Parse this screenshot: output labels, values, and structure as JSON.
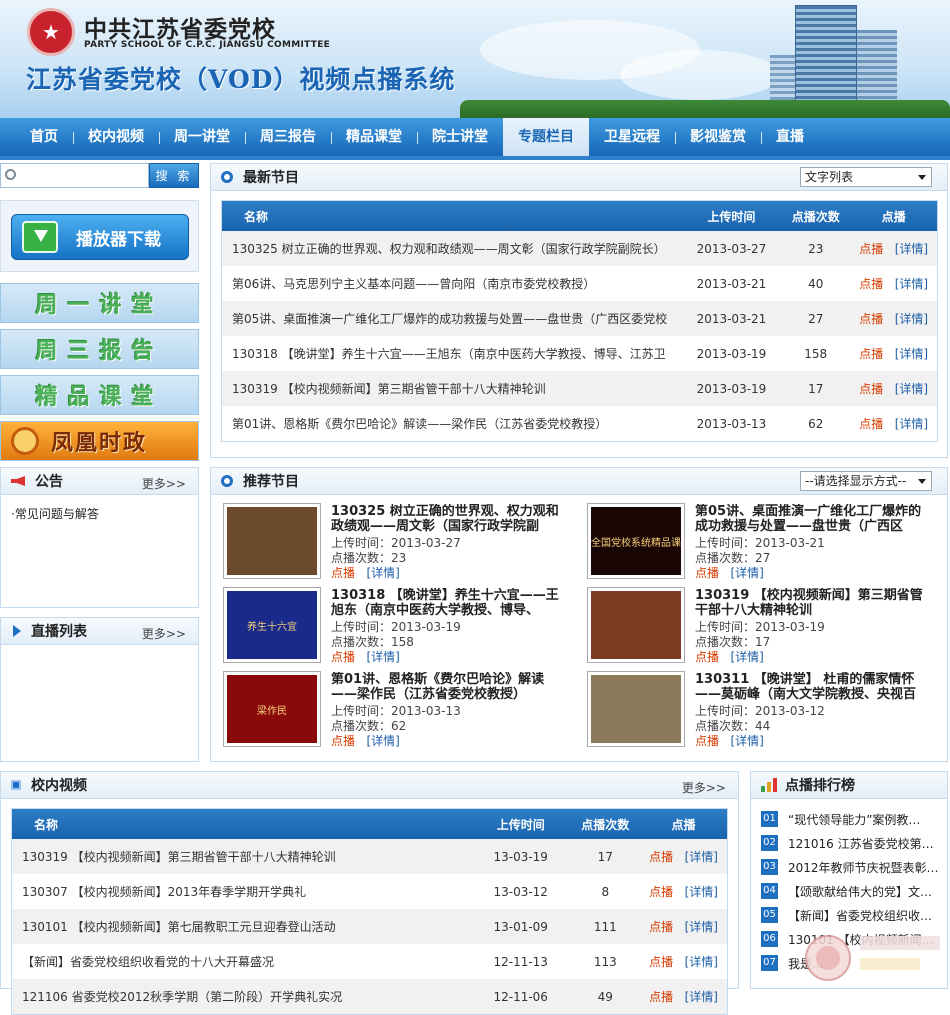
{
  "header": {
    "org_cn": "中共江苏省委党校",
    "org_en": "PARTY SCHOOL OF C.P.C. JIANGSU COMMITTEE",
    "system_title": "江苏省委党校（VOD）视频点播系统"
  },
  "nav": {
    "items": [
      "首页",
      "校内视频",
      "周一讲堂",
      "周三报告",
      "精品课堂",
      "院士讲堂",
      "专题栏目",
      "卫星远程",
      "影视鉴赏",
      "直播"
    ],
    "active_index": 6
  },
  "sidebar": {
    "search_button": "搜 索",
    "search_placeholder": "",
    "download_button": "播放器下载",
    "banners": [
      "周一讲堂",
      "周三报告",
      "精品课堂"
    ],
    "phoenix": "凤凰时政",
    "notice": {
      "title": "公告",
      "more": "更多>>",
      "items": [
        "·常见问题与解答"
      ]
    },
    "live": {
      "title": "直播列表",
      "more": "更多>>"
    }
  },
  "latest": {
    "title": "最新节目",
    "view_select": "文字列表",
    "columns": [
      "名称",
      "上传时间",
      "点播次数",
      "点播"
    ],
    "play_label": "点播",
    "detail_label": "[详情]",
    "rows": [
      {
        "name": "130325 树立正确的世界观、权力观和政绩观——周文彰（国家行政学院副院长）",
        "date": "2013-03-27",
        "count": "23"
      },
      {
        "name": "第06讲、马克思列宁主义基本问题——曾向阳（南京市委党校教授）",
        "date": "2013-03-21",
        "count": "40"
      },
      {
        "name": "第05讲、桌面推演一广维化工厂爆炸的成功救援与处置——盘世贵（广西区委党校",
        "date": "2013-03-21",
        "count": "27"
      },
      {
        "name": "130318 【晚讲堂】养生十六宜——王旭东（南京中医药大学教授、博导、江苏卫",
        "date": "2013-03-19",
        "count": "158"
      },
      {
        "name": "130319 【校内视频新闻】第三期省管干部十八大精神轮训",
        "date": "2013-03-19",
        "count": "17"
      },
      {
        "name": "第01讲、恩格斯《费尔巴哈论》解读——梁作民（江苏省委党校教授）",
        "date": "2013-03-13",
        "count": "62"
      }
    ]
  },
  "recommended": {
    "title": "推荐节目",
    "view_select": "--请选择显示方式--",
    "date_prefix": "上传时间：",
    "count_prefix": "点播次数：",
    "play_label": "点播",
    "detail_label": "[详情]",
    "items": [
      {
        "title": "130325 树立正确的世界观、权力观和政绩观——周文彰（国家行政学院副",
        "date": "2013-03-27",
        "count": "23",
        "thumb_text": "",
        "thumb_color": "#6b4a2e"
      },
      {
        "title": "第05讲、桌面推演一广维化工厂爆炸的成功救援与处置——盘世贵（广西区",
        "date": "2013-03-21",
        "count": "27",
        "thumb_text": "全国党校系统精品课",
        "thumb_color": "#1a0505"
      },
      {
        "title": "130318 【晚讲堂】养生十六宜——王旭东（南京中医药大学教授、博导、",
        "date": "2013-03-19",
        "count": "158",
        "thumb_text": "养生十六宜",
        "thumb_color": "#1a2a8a"
      },
      {
        "title": "130319 【校内视频新闻】第三期省管干部十八大精神轮训",
        "date": "2013-03-19",
        "count": "17",
        "thumb_text": "",
        "thumb_color": "#7a3b22"
      },
      {
        "title": "第01讲、恩格斯《费尔巴哈论》解读——梁作民（江苏省委党校教授）",
        "date": "2013-03-13",
        "count": "62",
        "thumb_text": "梁作民",
        "thumb_color": "#8a0a0a"
      },
      {
        "title": "130311 【晚讲堂】 杜甫的儒家情怀——莫砺峰（南大文学院教授、央视百",
        "date": "2013-03-12",
        "count": "44",
        "thumb_text": "",
        "thumb_color": "#8a7a5a"
      }
    ]
  },
  "campus": {
    "title": "校内视频",
    "more": "更多>>",
    "columns": [
      "名称",
      "上传时间",
      "点播次数",
      "点播"
    ],
    "play_label": "点播",
    "detail_label": "[详情]",
    "rows": [
      {
        "name": "130319 【校内视频新闻】第三期省管干部十八大精神轮训",
        "date": "13-03-19",
        "count": "17"
      },
      {
        "name": "130307 【校内视频新闻】2013年春季学期开学典礼",
        "date": "13-03-12",
        "count": "8"
      },
      {
        "name": "130101 【校内视频新闻】第七届教职工元旦迎春登山活动",
        "date": "13-01-09",
        "count": "111"
      },
      {
        "name": "【新闻】省委党校组织收看党的十八大开幕盛况",
        "date": "12-11-13",
        "count": "113"
      },
      {
        "name": "121106 省委党校2012秋季学期（第二阶段）开学典礼实况",
        "date": "12-11-06",
        "count": "49"
      }
    ]
  },
  "ranking": {
    "title": "点播排行榜",
    "items": [
      {
        "no": "01",
        "text": "“现代领导能力”案例教…"
      },
      {
        "no": "02",
        "text": "121016 江苏省委党校第…"
      },
      {
        "no": "03",
        "text": "2012年教师节庆祝暨表彰…"
      },
      {
        "no": "04",
        "text": "【颂歌献给伟大的党】文…"
      },
      {
        "no": "05",
        "text": "【新闻】省委党校组织收…"
      },
      {
        "no": "06",
        "text": "130101 【校内视频新闻…"
      },
      {
        "no": "07",
        "text": "我是…"
      }
    ]
  },
  "colors": {
    "nav": "#1766b5",
    "accent": "#1e6fc0",
    "play": "#d83c00",
    "detail": "#1d5fa8"
  }
}
